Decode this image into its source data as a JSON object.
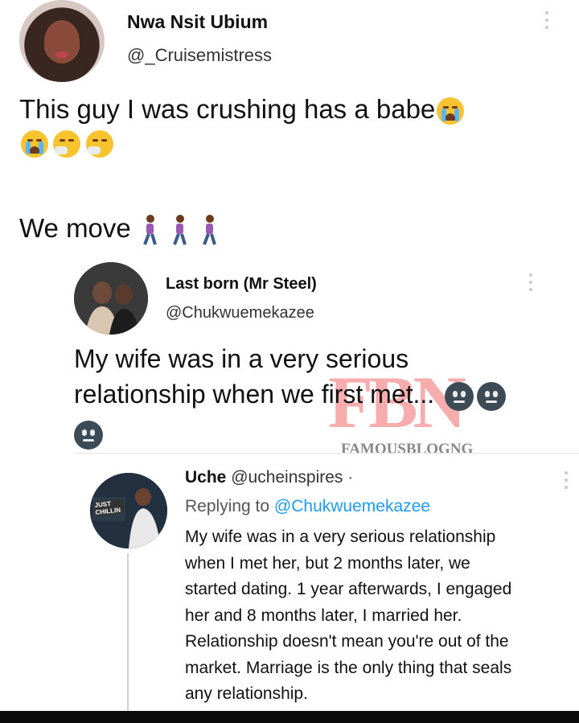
{
  "tweet1": {
    "name": "Nwa Nsit Ubium",
    "handle": "@_Cruisemistress",
    "line1": "This guy I was crushing has a babe",
    "line2": "We move"
  },
  "tweet2": {
    "name": "Last born (Mr Steel)",
    "handle": "@Chukwuemekazee",
    "line1": "My wife was in a very serious",
    "line2": "relationship when we first met..."
  },
  "watermark": {
    "logo": "FBN",
    "text": "FAMOUSBLOGNG"
  },
  "reply": {
    "name": "Uche",
    "handle": "@ucheinspires",
    "dot": "·",
    "replying_label": "Replying to",
    "replying_handle": "@Chukwuemekazee",
    "lines": [
      "My wife was in a very serious relationship",
      "when I met her, but 2 months later, we",
      "started dating. 1 year afterwards, I engaged",
      "her and 8 months later, I married her.",
      "Relationship doesn't mean you're out of the",
      "market. Marriage is the only thing that seals",
      "any relationship."
    ],
    "avatar_sign": "JUST CHILLIN"
  },
  "icons": {
    "crying_face": "loudly-crying-face",
    "sneezing_face": "sneezing-face",
    "walking_woman": "woman-walking",
    "neutral_face": "neutral-face"
  },
  "colors": {
    "link_blue": "#1d9bf0",
    "watermark_red": "#f26b6b"
  }
}
